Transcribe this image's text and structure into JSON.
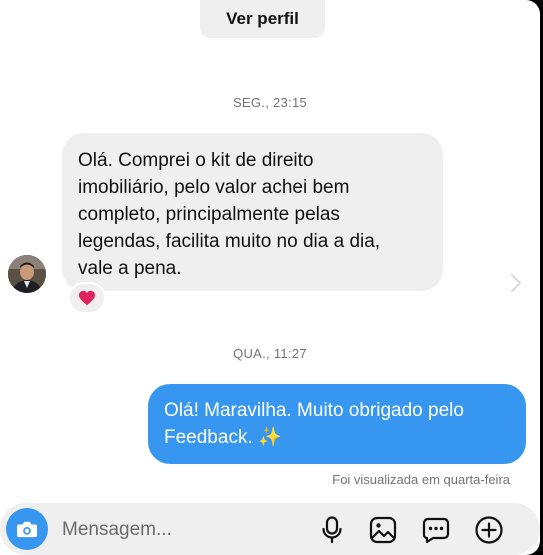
{
  "header": {
    "view_profile_label": "Ver perfil"
  },
  "conversation": {
    "timestamp_1": "SEG., 23:15",
    "incoming_message": {
      "lines": [
        "Olá. Comprei o kit de direito",
        "imobiliário, pelo valor achei bem",
        "completo, principalmente pelas",
        "legendas, facilita muito no dia a dia,",
        "vale a pena."
      ],
      "reaction": "heart"
    },
    "timestamp_2": "QUA., 11:27",
    "outgoing_message": {
      "lines": [
        "Olá! Maravilha. Muito obrigado pelo",
        "Feedback. ✨"
      ]
    },
    "seen_status": "Foi visualizada em quarta-feira"
  },
  "composer": {
    "placeholder": "Mensagem...",
    "icons": [
      "camera-icon",
      "microphone-icon",
      "image-icon",
      "sticker-icon",
      "plus-circle-icon"
    ]
  },
  "colors": {
    "accent": "#3797f0",
    "bubble_in": "#efefef",
    "reaction_heart": "#e0245e"
  }
}
